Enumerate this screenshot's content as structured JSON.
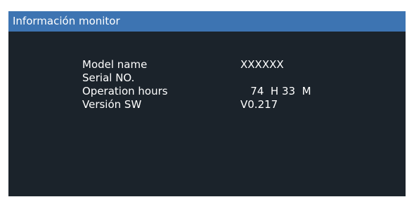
{
  "header": {
    "title": "Información monitor"
  },
  "info": {
    "rows": [
      {
        "label": "Model name",
        "value": "XXXXXX"
      },
      {
        "label": "Serial NO.",
        "value": ""
      },
      {
        "label": "Operation hours",
        "value": "   74  H 33  M"
      },
      {
        "label": "Versión SW",
        "value": "V0.217"
      }
    ]
  },
  "colors": {
    "header_bg": "#3d74b2",
    "panel_bg": "#1b232b",
    "text": "#ffffff"
  }
}
